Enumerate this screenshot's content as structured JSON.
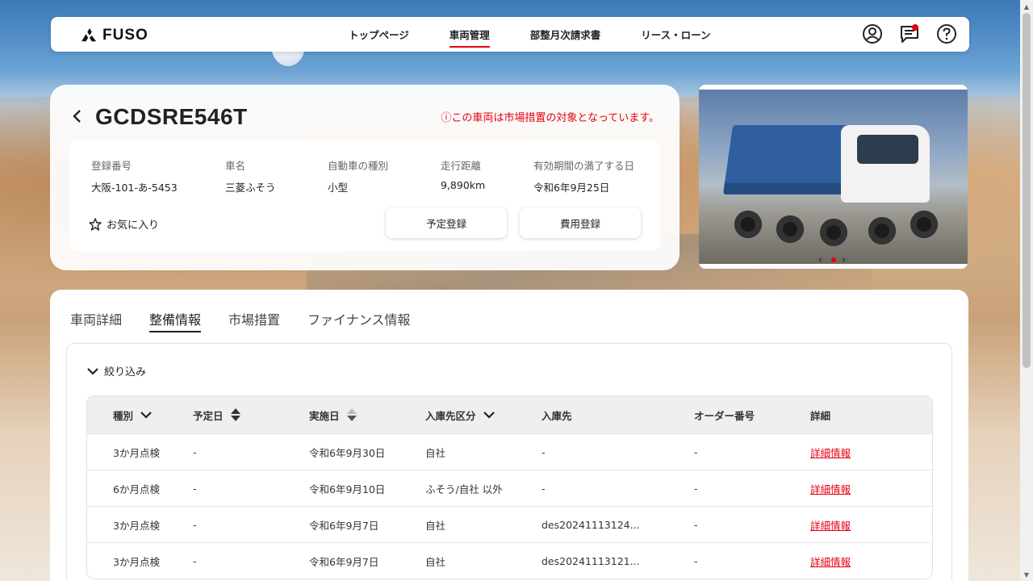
{
  "header": {
    "logo_text": "FUSO",
    "nav": [
      "トップページ",
      "車両管理",
      "部整月次請求書",
      "リース・ローン"
    ],
    "active_nav": 1
  },
  "vehicle": {
    "plate": "GCDSRE546T",
    "recall_notice": "ⓘこの車両は市場措置の対象となっています。",
    "fields": [
      {
        "label": "登録番号",
        "value": "大阪-101-あ-5453"
      },
      {
        "label": "車名",
        "value": "三菱ふそう"
      },
      {
        "label": "自動車の種別",
        "value": "小型"
      },
      {
        "label": "走行距離",
        "value": "9,890km"
      },
      {
        "label": "有効期間の満了する日",
        "value": "令和6年9月25日"
      }
    ],
    "favorite_label": "お気に入り",
    "schedule_button": "予定登録",
    "cost_button": "費用登録"
  },
  "carousel": {
    "active_index": 0
  },
  "tabs": [
    "車両詳細",
    "整備情報",
    "市場措置",
    "ファイナンス情報"
  ],
  "active_tab": 1,
  "filter_label": "絞り込み",
  "table": {
    "headers": [
      "種別",
      "予定日",
      "実施日",
      "入庫先区分",
      "入庫先",
      "オーダー番号",
      "詳細"
    ],
    "rows": [
      [
        "3か月点検",
        "-",
        "令和6年9月30日",
        "自社",
        "-",
        "-",
        "詳細情報"
      ],
      [
        "6か月点検",
        "-",
        "令和6年9月10日",
        "ふそう/自社 以外",
        "-",
        "-",
        "詳細情報"
      ],
      [
        "3か月点検",
        "-",
        "令和6年9月7日",
        "自社",
        "des20241113124...",
        "-",
        "詳細情報"
      ],
      [
        "3か月点検",
        "-",
        "令和6年9月7日",
        "自社",
        "des20241113121...",
        "-",
        "詳細情報"
      ]
    ]
  },
  "colors": {
    "accent": "#e60012",
    "card": "#ffffff",
    "table_header": "#efefef"
  }
}
